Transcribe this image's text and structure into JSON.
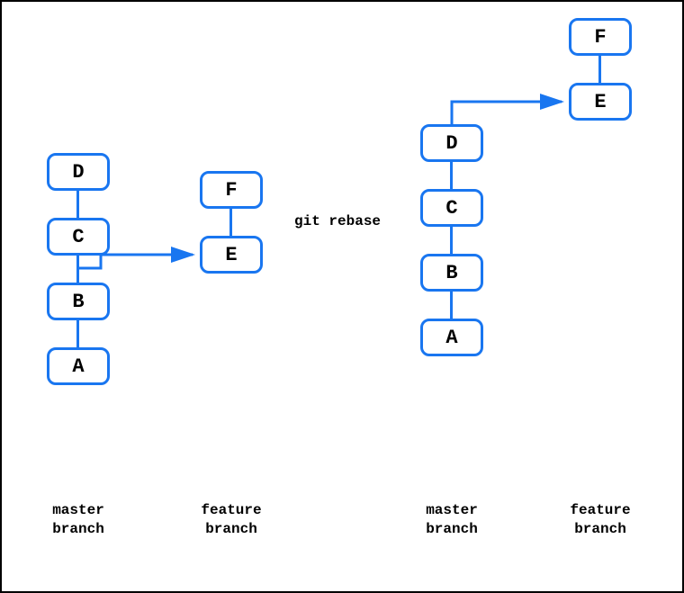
{
  "commits": {
    "left_master": [
      "A",
      "B",
      "C",
      "D"
    ],
    "left_feature": [
      "E",
      "F"
    ],
    "right_master": [
      "A",
      "B",
      "C",
      "D"
    ],
    "right_feature": [
      "E",
      "F"
    ]
  },
  "labels": {
    "rebase": "git rebase",
    "master1": "master",
    "branch1": "branch",
    "feature1": "feature",
    "master2": "master",
    "branch2": "branch",
    "feature2": "feature"
  },
  "colors": {
    "box_border": "#1976f0",
    "arrow_red": "#f44336",
    "arrow_blue": "#1976f0"
  }
}
